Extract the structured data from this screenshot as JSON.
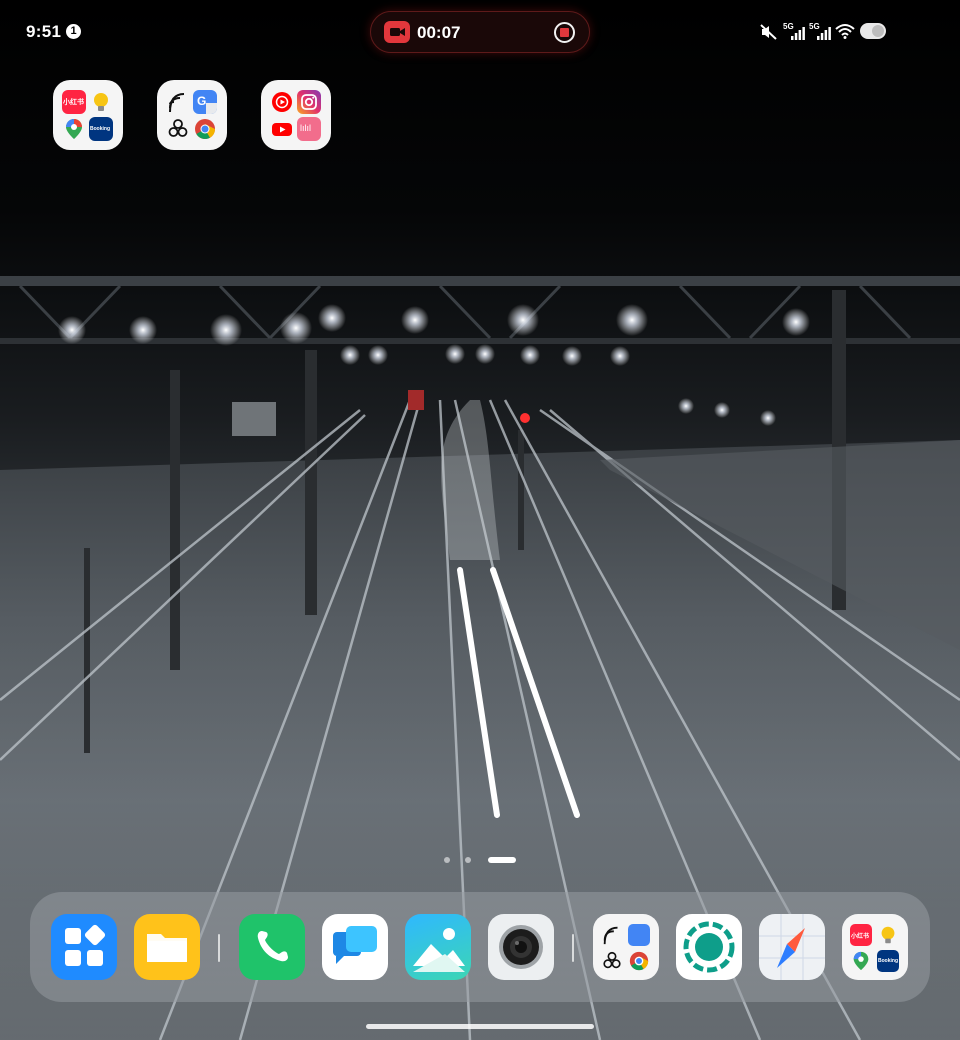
{
  "status_bar": {
    "time": "9:51",
    "notification_count": "1",
    "recording_time": "00:07",
    "network_label_1": "5G",
    "network_label_2": "5G"
  },
  "home": {
    "folders": [
      {
        "apps": [
          "xiaohongshu",
          "tips",
          "maps",
          "booking"
        ]
      },
      {
        "apps": [
          "nfc",
          "google-translate",
          "chatgpt",
          "chrome"
        ]
      },
      {
        "apps": [
          "youtube-music",
          "instagram",
          "youtube",
          "music-app"
        ]
      }
    ],
    "mini_labels": {
      "xiaohongshu": "小红书",
      "booking": "Booking",
      "translate": "G",
      "music": "lılıl"
    },
    "page_count": 3,
    "active_page": 3
  },
  "dock": {
    "apps": [
      "widgets",
      "files",
      "phone",
      "messages",
      "gallery",
      "camera",
      "folder-google",
      "screen-recorder",
      "compass",
      "folder-travel"
    ]
  },
  "colors": {
    "accent_red": "#e2373c",
    "phone_green": "#1fc36a",
    "dock_bg": "#969ba0"
  }
}
